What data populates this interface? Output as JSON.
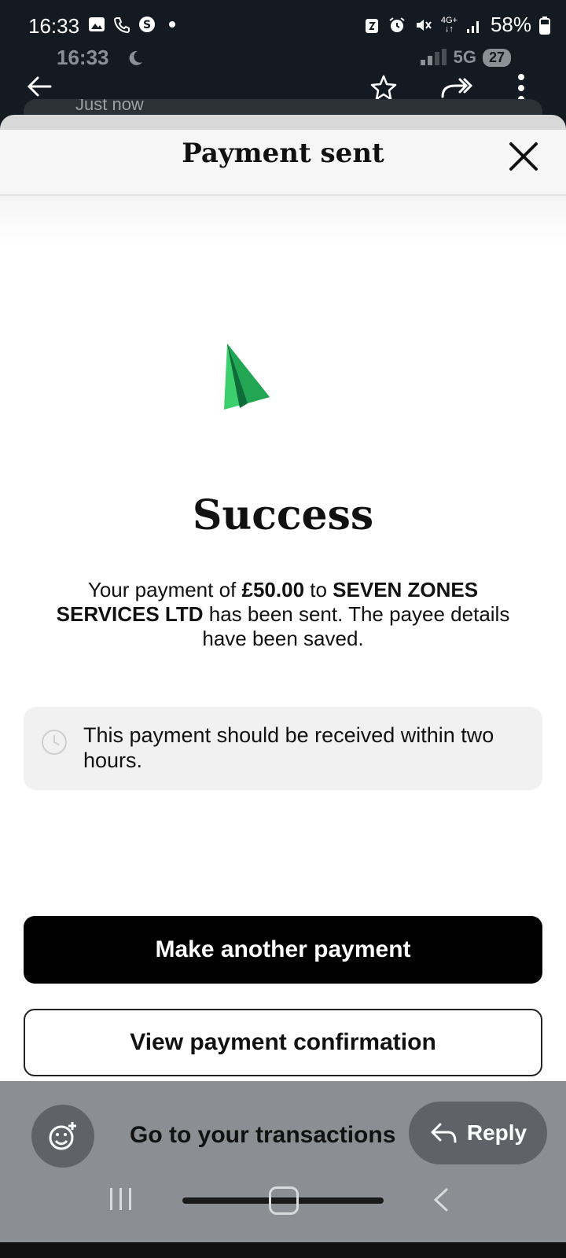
{
  "status_bar": {
    "time": "16:33",
    "battery": "58%",
    "network_top": "4G+",
    "left_icons": [
      "image-icon",
      "phone-icon",
      "s-app-icon",
      "dot-icon"
    ],
    "right_icons": [
      "battery-saver-icon",
      "alarm-icon",
      "mute-icon",
      "signal-icon",
      "battery-icon"
    ]
  },
  "viewer": {
    "time": "16:33",
    "network": "5G",
    "badge": "27",
    "just_now": "Just now"
  },
  "sheet": {
    "title": "Payment sent",
    "success_heading": "Success",
    "message": {
      "part1": "Your payment of ",
      "amount": "£50.00",
      "part2": " to ",
      "payee": "SEVEN ZONES SERVICES LTD",
      "part3": " has been sent. The payee details have been saved."
    },
    "info": "This payment should be received within two hours.",
    "primary_button": "Make another payment",
    "secondary_button": "View payment confirmation",
    "transactions_link": "Go to your transactions"
  },
  "overlay": {
    "reply_label": "Reply"
  },
  "colors": {
    "accent_green": "#3ccf6e",
    "dark_green": "#0e6b3a",
    "primary_button_bg": "#000000"
  }
}
